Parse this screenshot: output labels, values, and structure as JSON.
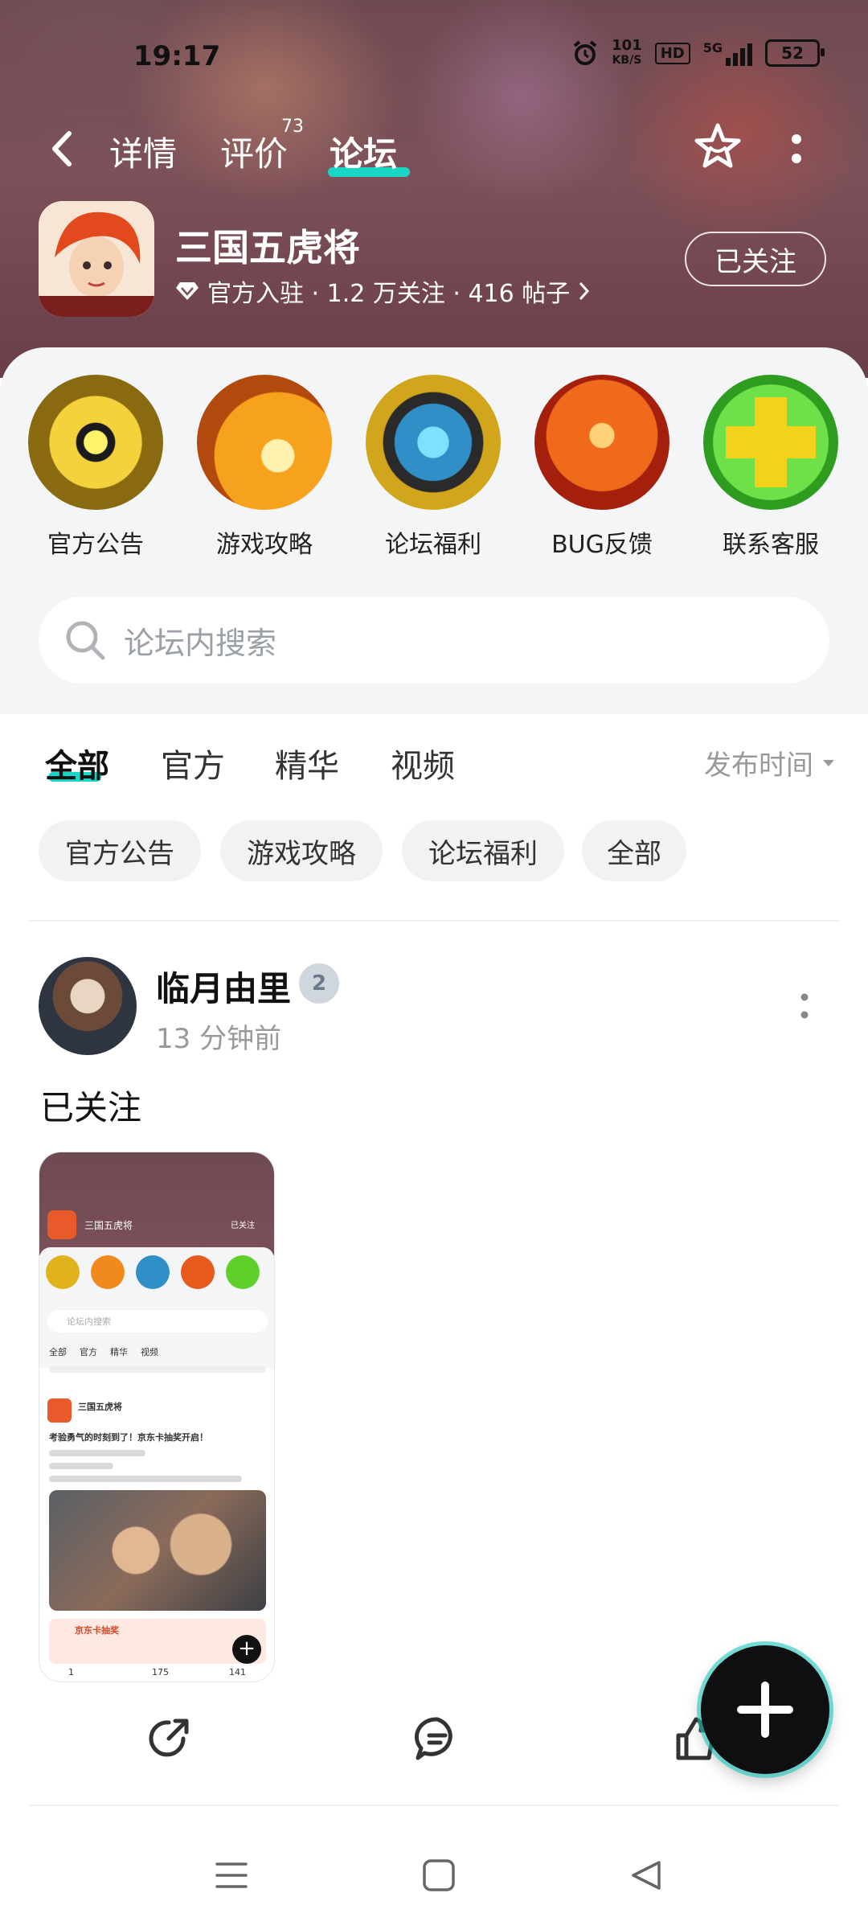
{
  "status_bar": {
    "time": "19:17",
    "speed_value": "101",
    "speed_unit": "KB/S",
    "hd": "HD",
    "network": "5G",
    "battery": "52"
  },
  "nav": {
    "tabs": [
      {
        "label": "详情"
      },
      {
        "label": "评价"
      },
      {
        "label": "论坛"
      }
    ],
    "review_count": "73",
    "active_tab": "论坛"
  },
  "game": {
    "name": "三国五虎将",
    "meta": "官方入驻 · 1.2 万关注 · 416 帖子",
    "follow_label": "已关注"
  },
  "categories": [
    {
      "label": "官方公告",
      "color": "#c99a1a"
    },
    {
      "label": "游戏攻略",
      "color": "#e8861c"
    },
    {
      "label": "论坛福利",
      "color": "#2f8fc6"
    },
    {
      "label": "BUG反馈",
      "color": "#e85a1c"
    },
    {
      "label": "联系客服",
      "color": "#4fc02a"
    }
  ],
  "search": {
    "placeholder": "论坛内搜索"
  },
  "filter_tabs": [
    {
      "label": "全部"
    },
    {
      "label": "官方"
    },
    {
      "label": "精华"
    },
    {
      "label": "视频"
    }
  ],
  "sort_label": "发布时间",
  "chips": [
    {
      "label": "官方公告"
    },
    {
      "label": "游戏攻略"
    },
    {
      "label": "论坛福利"
    },
    {
      "label": "全部"
    }
  ],
  "post": {
    "author": "临月由里",
    "level": "2",
    "time": "13 分钟前",
    "text": "已关注",
    "thumbnail": {
      "game_name": "三国五虎将",
      "follow": "已关注",
      "search": "论坛内搜索",
      "tabs": [
        "全部",
        "官方",
        "精华",
        "视频"
      ],
      "post_author": "三国五虎将",
      "post_title": "考验勇气的时刻到了！京东卡抽奖开启！",
      "card_title": "京东卡抽奖",
      "stats": [
        "1",
        "175",
        "141"
      ]
    }
  },
  "colors": {
    "accent": "#19d6c5",
    "hero": "#7d5159"
  }
}
